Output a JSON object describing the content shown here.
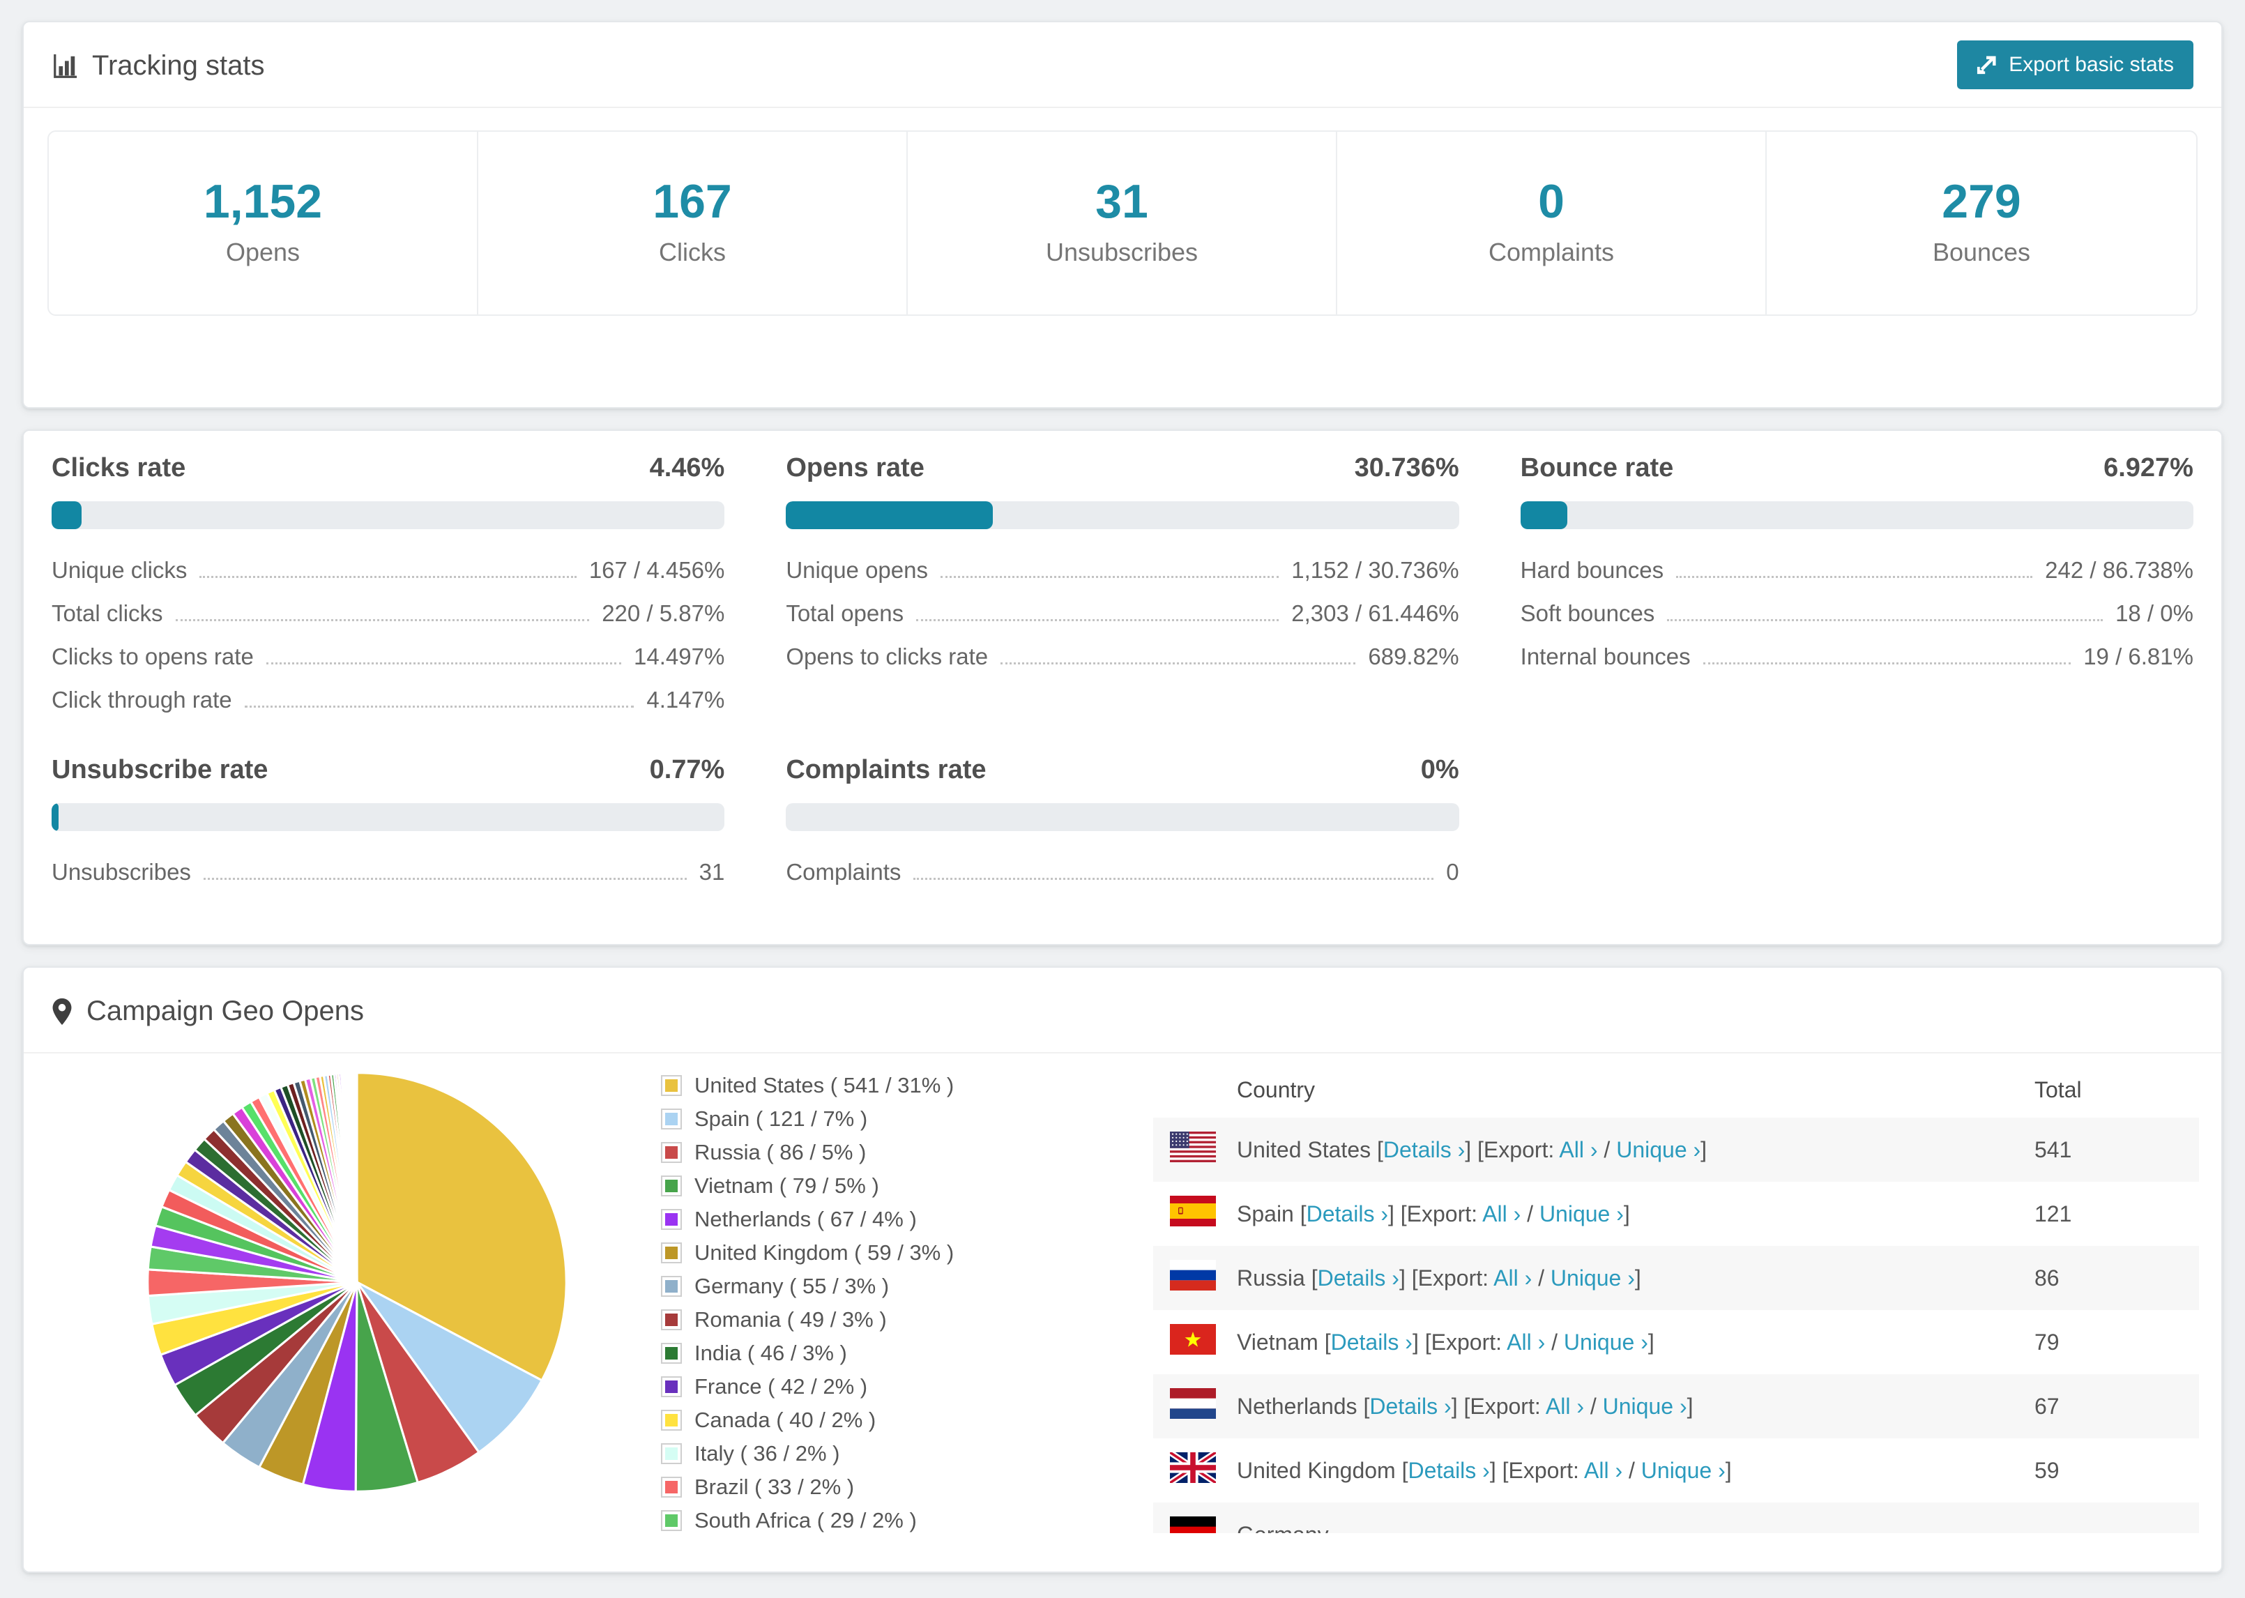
{
  "colors": {
    "accent_teal": "#1e8ca6",
    "button_teal": "#1e87a2",
    "bar_fill": "#1287a3",
    "link": "#2b9abd",
    "page_bg": "#eff1f3"
  },
  "tracking_stats": {
    "title": "Tracking stats",
    "export_button": "Export basic stats",
    "summary": [
      {
        "value": "1,152",
        "label": "Opens"
      },
      {
        "value": "167",
        "label": "Clicks"
      },
      {
        "value": "31",
        "label": "Unsubscribes"
      },
      {
        "value": "0",
        "label": "Complaints"
      },
      {
        "value": "279",
        "label": "Bounces"
      }
    ]
  },
  "rates": [
    {
      "title": "Clicks rate",
      "value": "4.46%",
      "percent": 4.46,
      "rows": [
        {
          "label": "Unique clicks",
          "value": "167 / 4.456%"
        },
        {
          "label": "Total clicks",
          "value": "220 / 5.87%"
        },
        {
          "label": "Clicks to opens rate",
          "value": "14.497%"
        },
        {
          "label": "Click through rate",
          "value": "4.147%"
        }
      ]
    },
    {
      "title": "Opens rate",
      "value": "30.736%",
      "percent": 30.736,
      "rows": [
        {
          "label": "Unique opens",
          "value": "1,152 / 30.736%"
        },
        {
          "label": "Total opens",
          "value": "2,303 / 61.446%"
        },
        {
          "label": "Opens to clicks rate",
          "value": "689.82%"
        }
      ]
    },
    {
      "title": "Bounce rate",
      "value": "6.927%",
      "percent": 6.927,
      "rows": [
        {
          "label": "Hard bounces",
          "value": "242 / 86.738%"
        },
        {
          "label": "Soft bounces",
          "value": "18 / 0%"
        },
        {
          "label": "Internal bounces",
          "value": "19 / 6.81%"
        }
      ]
    },
    {
      "title": "Unsubscribe rate",
      "value": "0.77%",
      "percent": 0.77,
      "rows": [
        {
          "label": "Unsubscribes",
          "value": "31"
        }
      ]
    },
    {
      "title": "Complaints rate",
      "value": "0%",
      "percent": 0,
      "rows": [
        {
          "label": "Complaints",
          "value": "0"
        }
      ]
    }
  ],
  "geo": {
    "title": "Campaign Geo Opens",
    "chart_data": {
      "type": "pie",
      "title": "Campaign Geo Opens",
      "unit": "opens",
      "legend_position": "right-of-pie",
      "start_angle_deg": 0,
      "direction": "clockwise",
      "labeled_slices": [
        {
          "label": "United States",
          "value": 541,
          "pct": 31,
          "color": "#e9c23f"
        },
        {
          "label": "Spain",
          "value": 121,
          "pct": 7,
          "color": "#abd3f2"
        },
        {
          "label": "Russia",
          "value": 86,
          "pct": 5,
          "color": "#c94a4a"
        },
        {
          "label": "Vietnam",
          "value": 79,
          "pct": 5,
          "color": "#47a44b"
        },
        {
          "label": "Netherlands",
          "value": 67,
          "pct": 4,
          "color": "#9a33f2"
        },
        {
          "label": "United Kingdom",
          "value": 59,
          "pct": 3,
          "color": "#bd9727"
        },
        {
          "label": "Germany",
          "value": 55,
          "pct": 3,
          "color": "#8fb0ca"
        },
        {
          "label": "Romania",
          "value": 49,
          "pct": 3,
          "color": "#a63a3a"
        },
        {
          "label": "India",
          "value": 46,
          "pct": 3,
          "color": "#2c7a33"
        },
        {
          "label": "France",
          "value": 42,
          "pct": 2,
          "color": "#6930bd"
        },
        {
          "label": "Canada",
          "value": 40,
          "pct": 2,
          "color": "#ffe23f"
        },
        {
          "label": "Italy",
          "value": 36,
          "pct": 2,
          "color": "#d5fdf4"
        },
        {
          "label": "Brazil",
          "value": 33,
          "pct": 2,
          "color": "#f66666"
        },
        {
          "label": "South Africa",
          "value": 29,
          "pct": 2,
          "color": "#5fc968"
        }
      ],
      "unlabeled_small_slices_estimated": [
        27,
        25,
        23,
        21,
        20,
        19,
        18,
        17,
        16,
        15,
        14,
        13,
        12,
        11,
        10,
        9,
        9,
        8,
        8,
        7,
        7,
        6,
        6,
        5,
        5,
        4,
        4,
        3,
        3,
        3,
        2,
        2,
        2,
        2,
        1.5,
        1.5,
        1,
        1,
        1,
        1,
        1,
        1,
        0.8,
        0.6,
        0.5,
        0.4,
        0.3,
        0.2
      ],
      "other_colors_cycle": [
        "#a43cf0",
        "#55c45e",
        "#f25c5c",
        "#ccfbf3",
        "#f6d53f",
        "#5b2da0",
        "#2c6e31",
        "#8d2f2f",
        "#6d8399",
        "#8a741f",
        "#d940d9",
        "#57e06a",
        "#ff7070",
        "#f4fffc",
        "#ffff55",
        "#3c2483",
        "#1e4f26",
        "#6d2020",
        "#44596e",
        "#b08c1e",
        "#e45fe4",
        "#7fe07f",
        "#ff8585",
        "#e9c23f",
        "#abd3f2",
        "#c94a4a",
        "#47a44b",
        "#9a33f2",
        "#bd9727"
      ]
    },
    "legend_format": "( value / pct% )",
    "table": {
      "country_header": "Country",
      "total_header": "Total",
      "link_labels": {
        "details": "Details ›",
        "export_prefix": "Export:",
        "all": "All ›",
        "unique": "Unique ›"
      },
      "rows": [
        {
          "country": "United States",
          "flag": "us",
          "total": "541"
        },
        {
          "country": "Spain",
          "flag": "es",
          "total": "121"
        },
        {
          "country": "Russia",
          "flag": "ru",
          "total": "86"
        },
        {
          "country": "Vietnam",
          "flag": "vn",
          "total": "79"
        },
        {
          "country": "Netherlands",
          "flag": "nl",
          "total": "67"
        },
        {
          "country": "United Kingdom",
          "flag": "gb",
          "total": "59"
        },
        {
          "country": "Germany",
          "flag": "de",
          "total": "",
          "clipped": true
        }
      ]
    }
  }
}
